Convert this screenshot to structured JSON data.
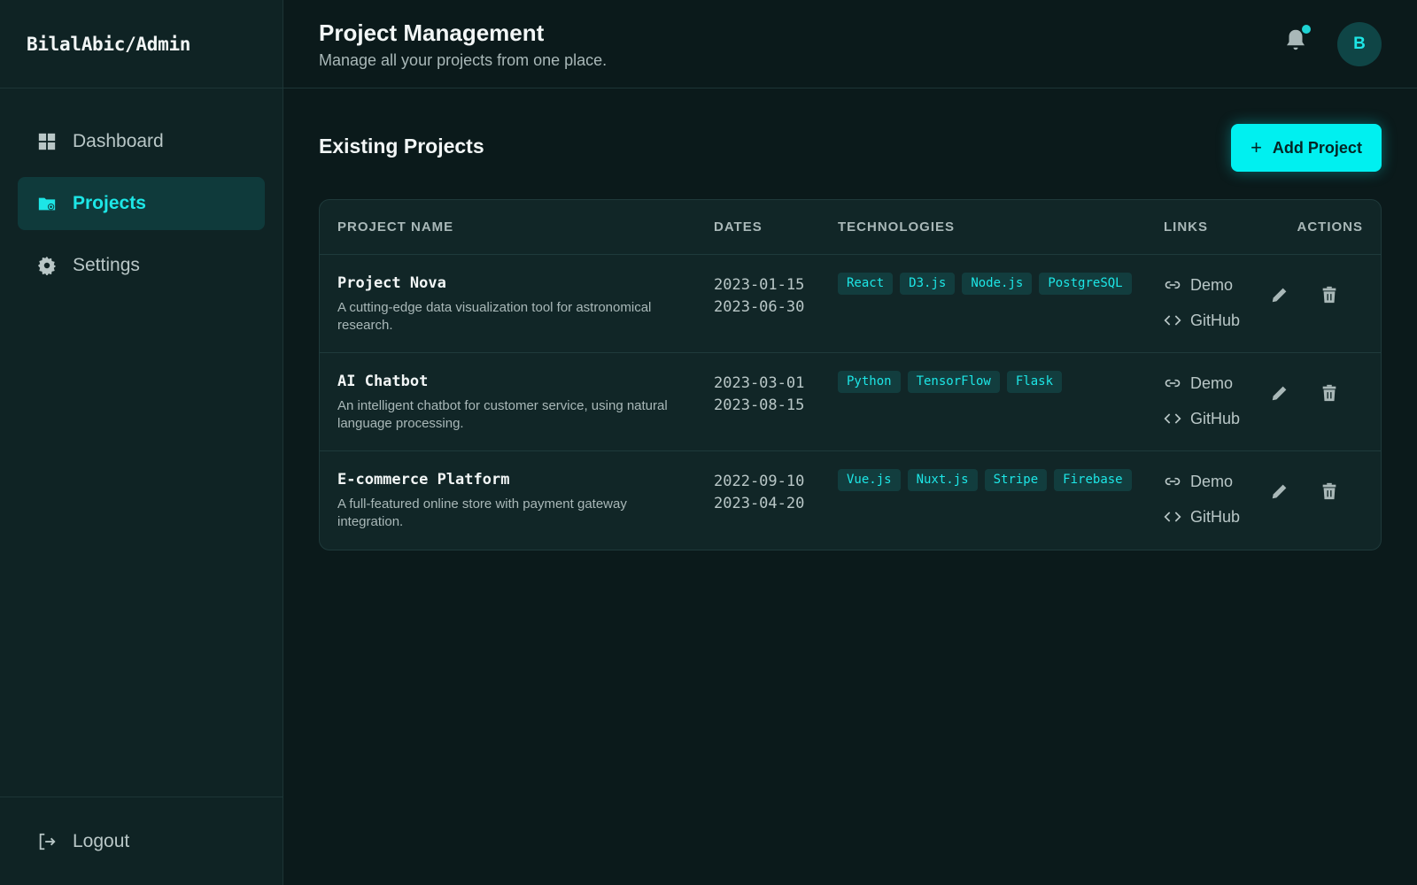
{
  "brand": "BilalAbic/Admin",
  "sidebar": {
    "items": [
      {
        "label": "Dashboard",
        "icon": "dashboard-icon",
        "active": false
      },
      {
        "label": "Projects",
        "icon": "folder-icon",
        "active": true
      },
      {
        "label": "Settings",
        "icon": "gear-icon",
        "active": false
      }
    ],
    "logout": "Logout"
  },
  "header": {
    "title": "Project Management",
    "subtitle": "Manage all your projects from one place.",
    "avatar_initial": "B"
  },
  "main": {
    "section_title": "Existing Projects",
    "add_button": "Add Project",
    "columns": [
      "PROJECT NAME",
      "DATES",
      "TECHNOLOGIES",
      "LINKS",
      "ACTIONS"
    ],
    "projects": [
      {
        "name": "Project Nova",
        "description": "A cutting-edge data visualization tool for astronomical research.",
        "start": "2023-01-15",
        "end": "2023-06-30",
        "tech": [
          "React",
          "D3.js",
          "Node.js",
          "PostgreSQL"
        ],
        "demo": "Demo",
        "github": "GitHub"
      },
      {
        "name": "AI Chatbot",
        "description": "An intelligent chatbot for customer service, using natural language processing.",
        "start": "2023-03-01",
        "end": "2023-08-15",
        "tech": [
          "Python",
          "TensorFlow",
          "Flask"
        ],
        "demo": "Demo",
        "github": "GitHub"
      },
      {
        "name": "E-commerce Platform",
        "description": "A full-featured online store with payment gateway integration.",
        "start": "2022-09-10",
        "end": "2023-04-20",
        "tech": [
          "Vue.js",
          "Nuxt.js",
          "Stripe",
          "Firebase"
        ],
        "demo": "Demo",
        "github": "GitHub"
      }
    ]
  },
  "colors": {
    "accent": "#00f0f0",
    "background": "#0b1a1b",
    "sidebar": "#0f2324"
  }
}
